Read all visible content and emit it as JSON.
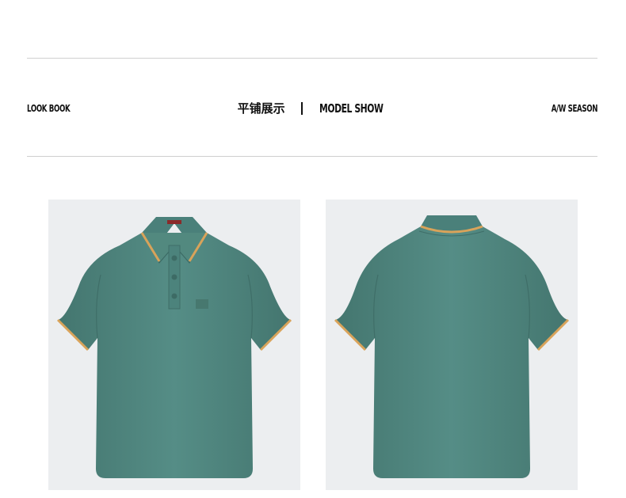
{
  "header": {
    "left_label": "LOOK BOOK",
    "center_cn": "平铺展示",
    "center_en": "MODEL SHOW",
    "right_label": "A/W SEASON"
  },
  "products": [
    {
      "view": "front",
      "garment": "polo-shirt",
      "color": "#4f8780",
      "trim_color": "#d9a35a"
    },
    {
      "view": "back",
      "garment": "polo-shirt",
      "color": "#4f8780",
      "trim_color": "#d9a35a"
    }
  ],
  "colors": {
    "background": "#ffffff",
    "panel": "#eceef0",
    "rule": "#cfcfcf",
    "text": "#111111"
  }
}
